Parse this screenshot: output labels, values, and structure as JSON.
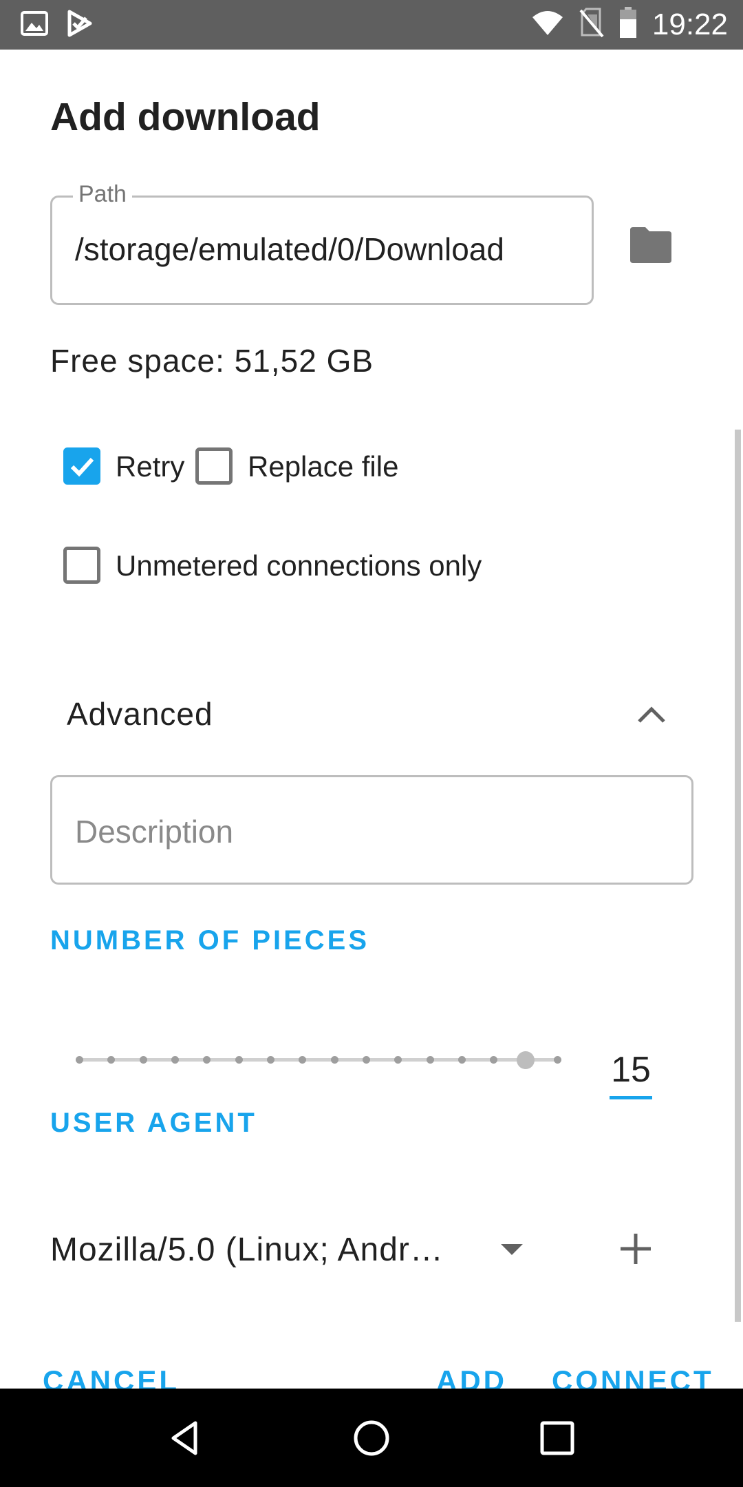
{
  "status_bar": {
    "time": "19:22",
    "left_icons": [
      "image-icon",
      "play-store-icon"
    ],
    "right_icons": [
      "wifi-icon",
      "no-sim-icon",
      "battery-icon"
    ]
  },
  "dialog": {
    "title": "Add download",
    "path": {
      "label": "Path",
      "value": "/storage/emulated/0/Download"
    },
    "free_space": "Free space: 51,52 GB",
    "checkboxes": {
      "retry": {
        "label": "Retry",
        "checked": true
      },
      "replace_file": {
        "label": "Replace file",
        "checked": false
      },
      "unmetered": {
        "label": "Unmetered connections only",
        "checked": false
      }
    },
    "advanced": {
      "label": "Advanced",
      "expanded": true
    },
    "description": {
      "placeholder": "Description",
      "value": ""
    },
    "pieces": {
      "label": "NUMBER OF PIECES",
      "value": "15",
      "min": 1,
      "max": 16,
      "current": 15
    },
    "user_agent": {
      "label": "USER AGENT",
      "value": "Mozilla/5.0 (Linux; Andr…"
    },
    "buttons": {
      "cancel": "CANCEL",
      "add": "ADD",
      "connect": "CONNECT"
    }
  },
  "colors": {
    "accent": "#18a4ec",
    "status_bar": "#5f5f5f",
    "nav_bar": "#000000"
  }
}
